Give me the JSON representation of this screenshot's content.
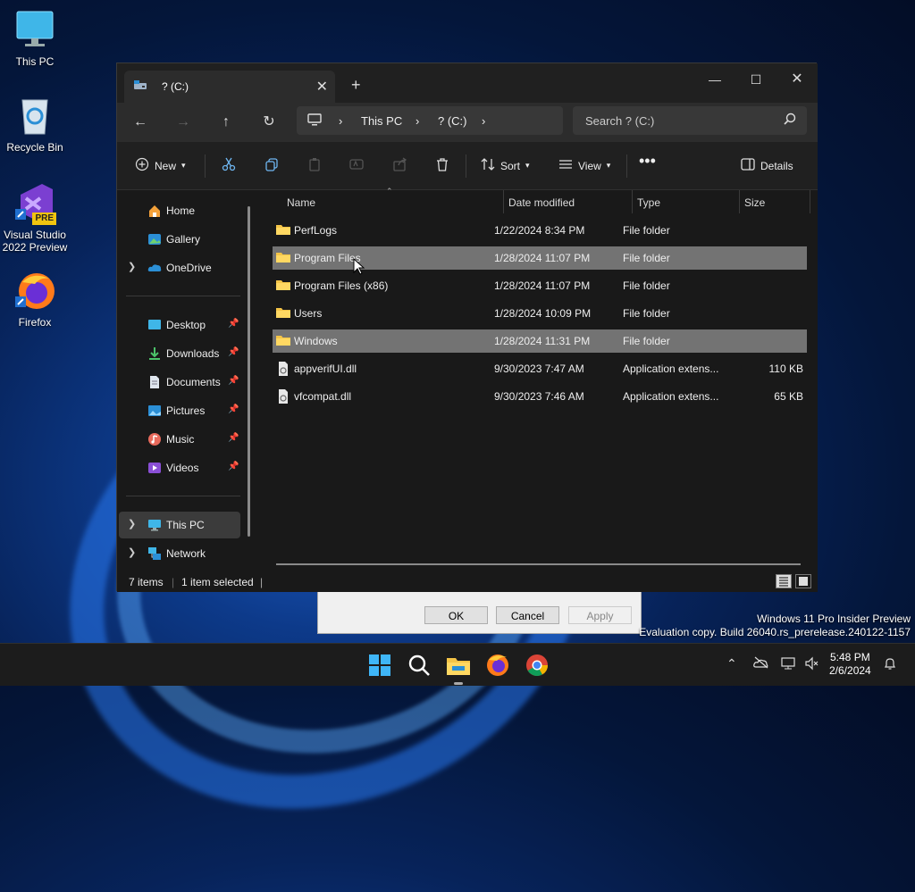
{
  "desktop": {
    "icons": [
      {
        "label": "This PC",
        "icon": "monitor-icon"
      },
      {
        "label": "Recycle Bin",
        "icon": "recycle-bin-icon"
      },
      {
        "label": "Visual Studio 2022 Preview",
        "badge": "PRE",
        "icon": "visual-studio-icon"
      },
      {
        "label": "Firefox",
        "icon": "firefox-icon"
      }
    ]
  },
  "dialog_behind": {
    "ok": "OK",
    "cancel": "Cancel",
    "apply": "Apply"
  },
  "explorer": {
    "tab_title": "? (C:)",
    "new_tab": "+",
    "breadcrumb": [
      "This PC",
      "? (C:)"
    ],
    "search_placeholder": "Search ? (C:)",
    "commands": {
      "new": "New",
      "sort": "Sort",
      "view": "View",
      "details": "Details"
    },
    "nav": {
      "home": "Home",
      "gallery": "Gallery",
      "onedrive": "OneDrive",
      "desktop": "Desktop",
      "downloads": "Downloads",
      "documents": "Documents",
      "pictures": "Pictures",
      "music": "Music",
      "videos": "Videos",
      "this_pc": "This PC",
      "network": "Network"
    },
    "columns": {
      "name": "Name",
      "date": "Date modified",
      "type": "Type",
      "size": "Size"
    },
    "files": [
      {
        "name": "PerfLogs",
        "date": "1/22/2024 8:34 PM",
        "type": "File folder",
        "size": "",
        "kind": "folder",
        "selected": false
      },
      {
        "name": "Program Files",
        "date": "1/28/2024 11:07 PM",
        "type": "File folder",
        "size": "",
        "kind": "folder",
        "selected": true
      },
      {
        "name": "Program Files (x86)",
        "date": "1/28/2024 11:07 PM",
        "type": "File folder",
        "size": "",
        "kind": "folder",
        "selected": false
      },
      {
        "name": "Users",
        "date": "1/28/2024 10:09 PM",
        "type": "File folder",
        "size": "",
        "kind": "folder",
        "selected": false
      },
      {
        "name": "Windows",
        "date": "1/28/2024 11:31 PM",
        "type": "File folder",
        "size": "",
        "kind": "folder",
        "selected": true
      },
      {
        "name": "appverifUI.dll",
        "date": "9/30/2023 7:47 AM",
        "type": "Application extens...",
        "size": "110 KB",
        "kind": "file",
        "selected": false
      },
      {
        "name": "vfcompat.dll",
        "date": "9/30/2023 7:46 AM",
        "type": "Application extens...",
        "size": "65 KB",
        "kind": "file",
        "selected": false
      }
    ],
    "status": {
      "items": "7 items",
      "selected": "1 item selected"
    }
  },
  "watermark": {
    "line1": "Windows 11 Pro Insider Preview",
    "line2": "Evaluation copy. Build 26040.rs_prerelease.240122-1157"
  },
  "taskbar": {
    "time": "5:48 PM",
    "date": "2/6/2024",
    "apps": [
      "start-icon",
      "search-icon",
      "file-explorer-icon",
      "firefox-icon",
      "chrome-icon"
    ]
  },
  "colors": {
    "folder": "#f4c447",
    "selection": "#737373",
    "accent": "#60cdff"
  }
}
